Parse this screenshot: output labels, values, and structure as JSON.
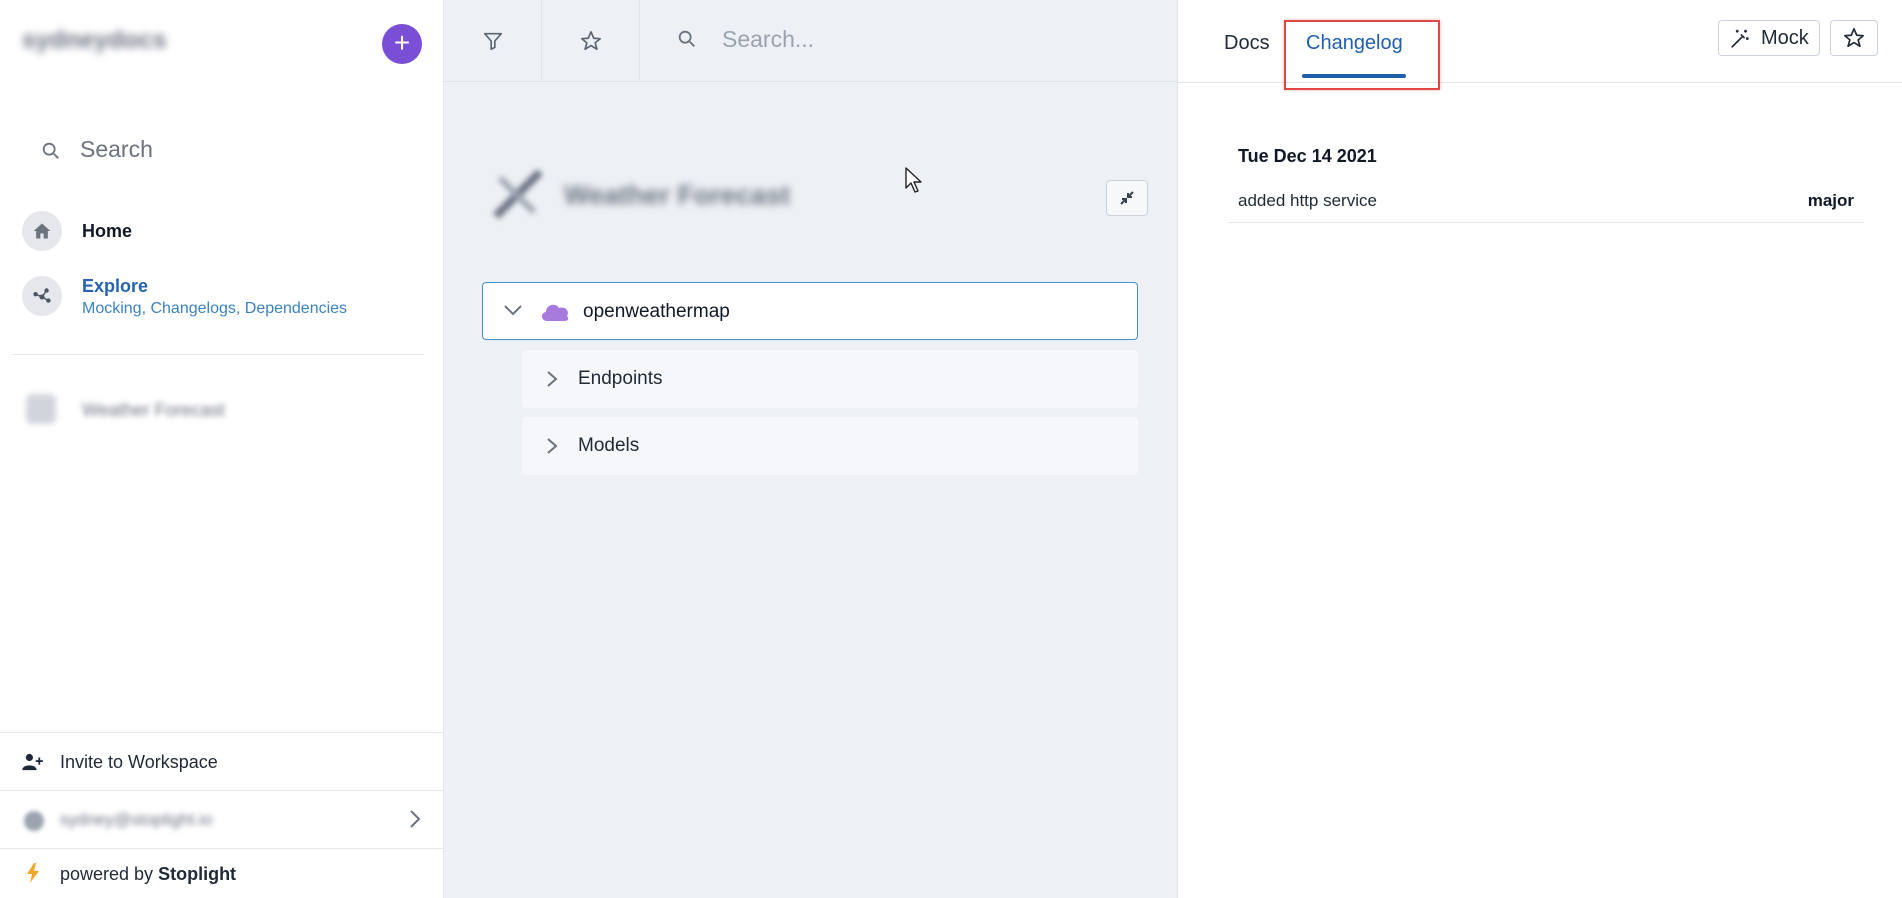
{
  "sidebar": {
    "workspace_name": "sydneydocs",
    "search_label": "Search",
    "nav": {
      "home": "Home",
      "explore": "Explore",
      "explore_sub": "Mocking, Changelogs, Dependencies"
    },
    "projects": [
      {
        "label": "Weather Forecast"
      }
    ],
    "invite_label": "Invite to Workspace",
    "user_email": "sydney@stoplight.io",
    "powered_prefix": "powered by",
    "powered_brand": "Stoplight"
  },
  "middle": {
    "search_placeholder": "Search...",
    "project_title": "Weather Forecast",
    "tree": {
      "root": "openweathermap",
      "children": [
        "Endpoints",
        "Models"
      ]
    }
  },
  "right": {
    "tabs": {
      "docs": "Docs",
      "changelog": "Changelog"
    },
    "active_tab": "Changelog",
    "mock_label": "Mock",
    "changelog": {
      "date": "Tue Dec 14 2021",
      "entries": [
        {
          "description": "added http service",
          "level": "major"
        }
      ]
    }
  },
  "colors": {
    "accent_purple": "#7a4fd6",
    "link_blue": "#1f5fae",
    "highlight_red": "#e04848",
    "panel_bg": "#edf1f5"
  },
  "icons": [
    "plus-icon",
    "search-icon",
    "home-icon",
    "explore-icon",
    "user-plus-icon",
    "chevron-right-icon",
    "bolt-icon",
    "filter-icon",
    "star-icon",
    "collapse-icon",
    "chevron-down-icon",
    "cloud-icon",
    "magic-wand-icon",
    "cursor-icon"
  ]
}
